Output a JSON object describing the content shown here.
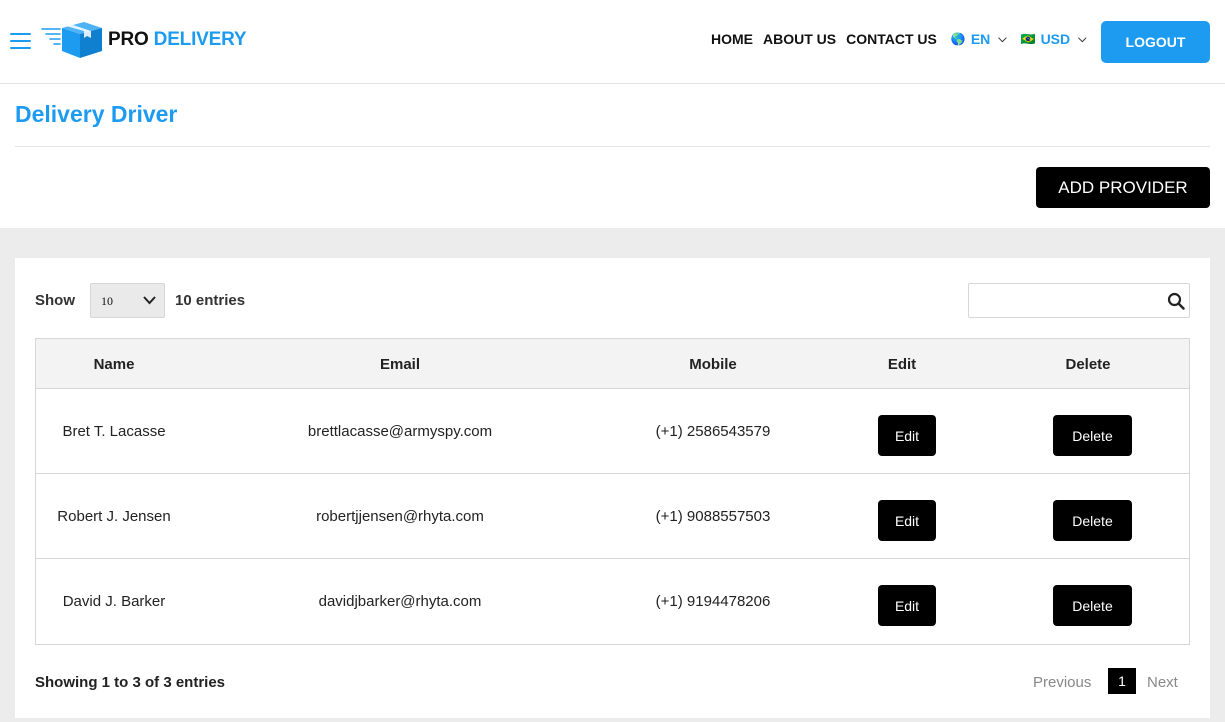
{
  "header": {
    "logo": {
      "pro": "PRO",
      "delivery": "DELIVERY"
    },
    "nav": [
      "HOME",
      "ABOUT US",
      "CONTACT US"
    ],
    "language": {
      "flag": "🌎",
      "label": "EN"
    },
    "currency": {
      "flag": "🇧🇷",
      "label": "USD"
    },
    "logout": "LOGOUT"
  },
  "page": {
    "title": "Delivery Driver",
    "add_button": "ADD PROVIDER"
  },
  "table_controls": {
    "show_label": "Show",
    "page_size": "10",
    "entries_label": "10 entries",
    "search_placeholder": ""
  },
  "table": {
    "columns": [
      "Name",
      "Email",
      "Mobile",
      "Edit",
      "Delete"
    ],
    "rows": [
      {
        "name": "Bret T. Lacasse",
        "email": "brettlacasse@armyspy.com",
        "mobile": "(+1) 2586543579",
        "edit": "Edit",
        "delete": "Delete"
      },
      {
        "name": "Robert J. Jensen",
        "email": "robertjjensen@rhyta.com",
        "mobile": "(+1) 9088557503",
        "edit": "Edit",
        "delete": "Delete"
      },
      {
        "name": "David J. Barker",
        "email": "davidjbarker@rhyta.com",
        "mobile": "(+1) 9194478206",
        "edit": "Edit",
        "delete": "Delete"
      }
    ]
  },
  "footer": {
    "info": "Showing 1 to 3 of 3 entries",
    "previous": "Previous",
    "current_page": "1",
    "next": "Next"
  },
  "colors": {
    "accent": "#1d9bf0",
    "button": "#000000",
    "panel": "#ececec"
  }
}
